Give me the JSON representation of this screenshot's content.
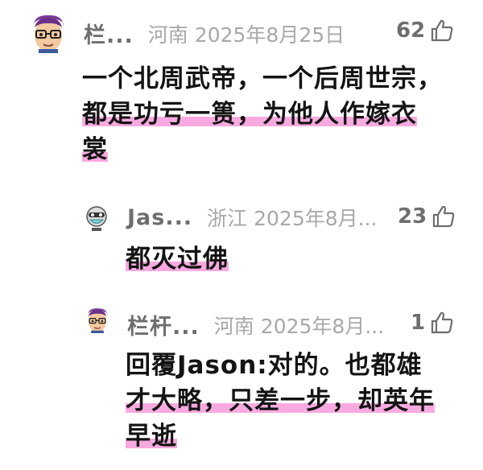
{
  "comments": [
    {
      "username": "栏...",
      "location": "河南",
      "date": "2025年8月25日",
      "likes": "62",
      "lines": [
        "一个北周武帝，一个后周世宗，",
        "都是功亏一篑，为他人作嫁衣",
        "裳"
      ]
    },
    {
      "username": "Jas...",
      "location": "浙江",
      "date": "2025年8月...",
      "likes": "23",
      "lines": [
        "都灭过佛"
      ]
    },
    {
      "username": "栏杆...",
      "location": "河南",
      "date": "2025年8月...",
      "likes": "1",
      "lines": [
        "回覆Jason:对的。也都雄",
        "才大略，只差一步，却英年",
        "早逝"
      ]
    }
  ],
  "icons": {
    "like": "thumbs-up-icon",
    "avatar_main": "avatar-cartoon-glasses",
    "avatar_jason": "avatar-robot-mask"
  },
  "colors": {
    "highlight": "#F68ED6",
    "username": "#6E6E6E",
    "meta": "#A8A8A8"
  }
}
